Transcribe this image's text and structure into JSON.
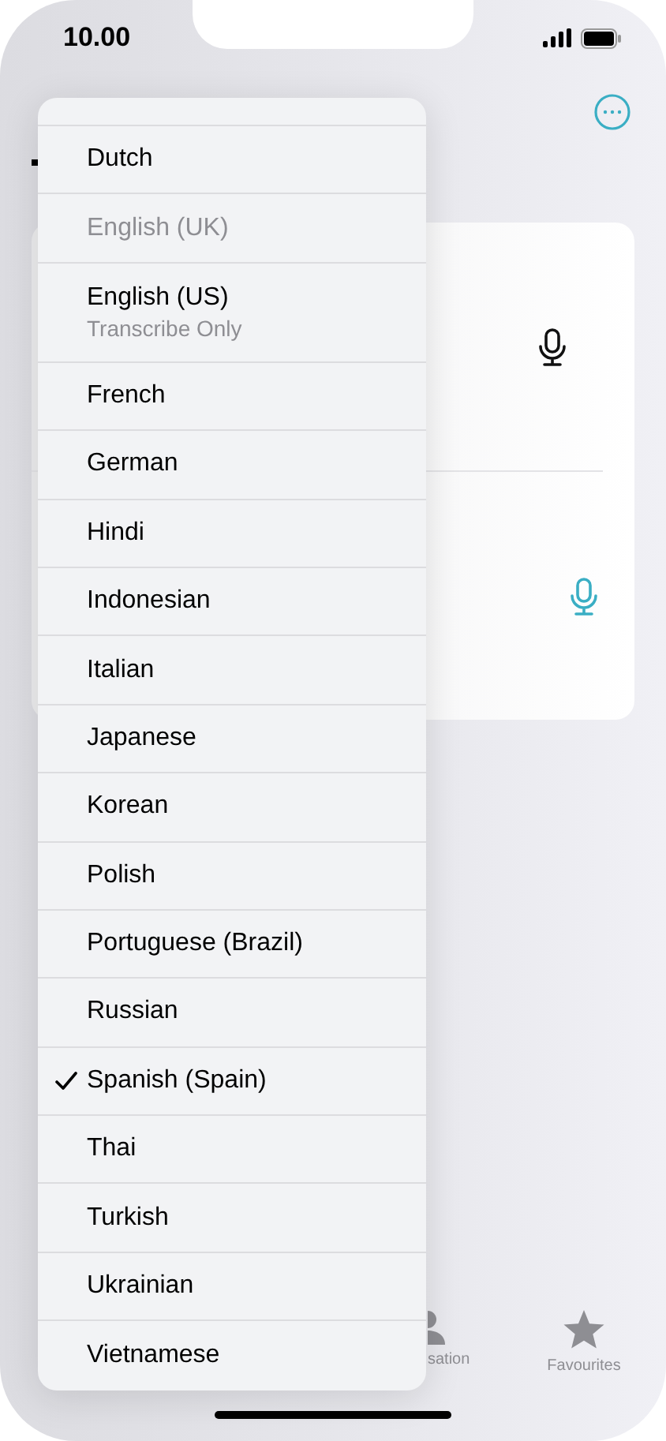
{
  "status_bar": {
    "time": "10.00"
  },
  "card": {
    "rows": [
      {
        "active": false
      },
      {
        "active": true
      }
    ]
  },
  "menu": {
    "items": [
      {
        "label": "Dutch",
        "disabled": false,
        "checked": false
      },
      {
        "label": "English (UK)",
        "disabled": true,
        "checked": false
      },
      {
        "label": "English (US)",
        "subtitle": "Transcribe Only",
        "disabled": false,
        "checked": false
      },
      {
        "label": "French",
        "disabled": false,
        "checked": false
      },
      {
        "label": "German",
        "disabled": false,
        "checked": false
      },
      {
        "label": "Hindi",
        "disabled": false,
        "checked": false
      },
      {
        "label": "Indonesian",
        "disabled": false,
        "checked": false
      },
      {
        "label": "Italian",
        "disabled": false,
        "checked": false
      },
      {
        "label": "Japanese",
        "disabled": false,
        "checked": false
      },
      {
        "label": "Korean",
        "disabled": false,
        "checked": false
      },
      {
        "label": "Polish",
        "disabled": false,
        "checked": false
      },
      {
        "label": "Portuguese (Brazil)",
        "disabled": false,
        "checked": false
      },
      {
        "label": "Russian",
        "disabled": false,
        "checked": false
      },
      {
        "label": "Spanish (Spain)",
        "disabled": false,
        "checked": true
      },
      {
        "label": "Thai",
        "disabled": false,
        "checked": false
      },
      {
        "label": "Turkish",
        "disabled": false,
        "checked": false
      },
      {
        "label": "Ukrainian",
        "disabled": false,
        "checked": false
      },
      {
        "label": "Vietnamese",
        "disabled": false,
        "checked": false
      }
    ]
  },
  "tab_bar": {
    "items": [
      {
        "kind": "person",
        "label": "sation"
      },
      {
        "kind": "star",
        "label": "Favourites"
      }
    ]
  }
}
